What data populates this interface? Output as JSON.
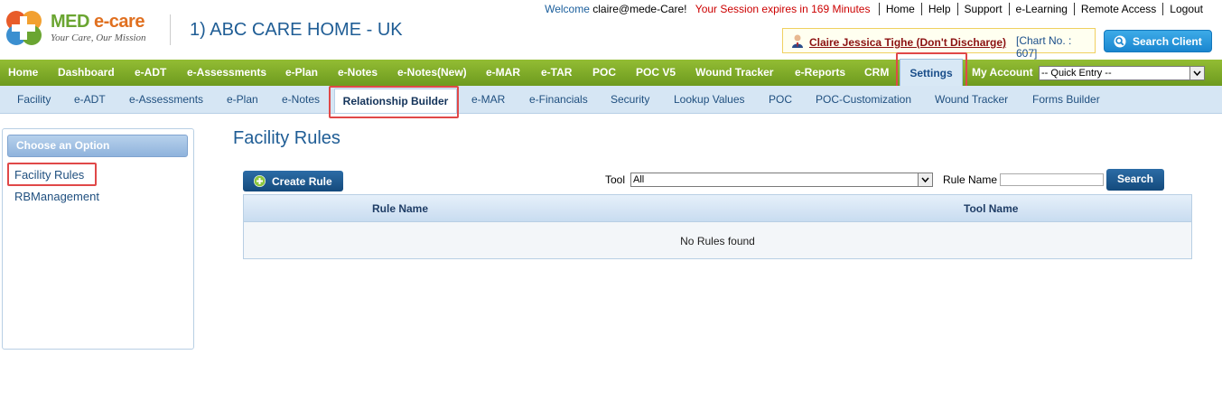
{
  "header": {
    "brand": {
      "name_part1": "MED ",
      "name_part2": "e-care",
      "tagline": "Your Care, Our Mission"
    },
    "facility": "1) ABC CARE HOME - UK",
    "welcome_label": "Welcome",
    "user": "claire@mede-Care!",
    "session": "Your Session expires in 169 Minutes",
    "links": [
      "Home",
      "Help",
      "Support",
      "e-Learning",
      "Remote Access",
      "Logout"
    ],
    "client_name": "Claire Jessica Tighe (Don't Discharge)",
    "chart_no": "[Chart No. : 607]",
    "search_client_label": "Search Client"
  },
  "main_nav": {
    "items": [
      "Home",
      "Dashboard",
      "e-ADT",
      "e-Assessments",
      "e-Plan",
      "e-Notes",
      "e-Notes(New)",
      "e-MAR",
      "e-TAR",
      "POC",
      "POC V5",
      "Wound Tracker",
      "e-Reports",
      "CRM",
      "Settings",
      "My Account"
    ],
    "active": "Settings",
    "quick_entry": "-- Quick Entry --"
  },
  "sub_nav": {
    "items": [
      "Facility",
      "e-ADT",
      "e-Assessments",
      "e-Plan",
      "e-Notes",
      "Relationship Builder",
      "e-MAR",
      "e-Financials",
      "Security",
      "Lookup Values",
      "POC",
      "POC-Customization",
      "Wound Tracker",
      "Forms Builder"
    ],
    "active": "Relationship Builder"
  },
  "left_panel": {
    "header": "Choose an Option",
    "options": [
      "Facility Rules",
      "RBManagement"
    ]
  },
  "content": {
    "title": "Facility Rules",
    "create_rule_label": "Create Rule",
    "tool_label": "Tool",
    "tool_value": "All",
    "rule_name_label": "Rule Name",
    "rule_name_value": "",
    "search_label": "Search",
    "columns": [
      "Rule Name",
      "Tool Name"
    ],
    "empty_message": "No Rules found"
  },
  "colors": {
    "nav_green": "#7faa28",
    "link_blue": "#1f5d95",
    "highlight_red": "#e04848",
    "session_red": "#cc0000"
  }
}
